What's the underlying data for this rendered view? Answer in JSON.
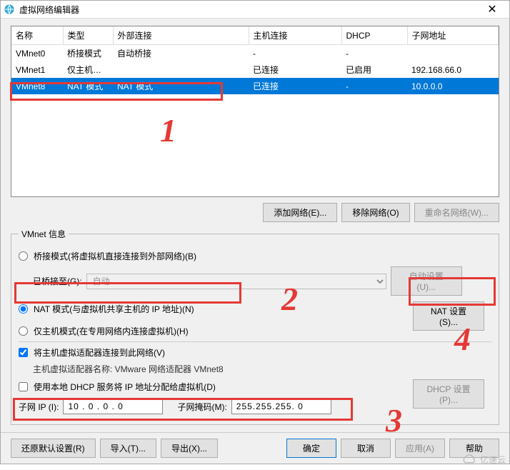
{
  "window": {
    "title": "虚拟网络编辑器",
    "close": "✕"
  },
  "headers": {
    "name": "名称",
    "type": "类型",
    "ext": "外部连接",
    "host": "主机连接",
    "dhcp": "DHCP",
    "subnet": "子网地址"
  },
  "rows": [
    {
      "name": "VMnet0",
      "type": "桥接模式",
      "ext": "自动桥接",
      "host": "-",
      "dhcp": "-",
      "subnet": ""
    },
    {
      "name": "VMnet1",
      "type": "仅主机…",
      "ext": "",
      "host": "已连接",
      "dhcp": "已启用",
      "subnet": "192.168.66.0"
    },
    {
      "name": "VMnet8",
      "type": "NAT 模式",
      "ext": "NAT 模式",
      "host": "已连接",
      "dhcp": "-",
      "subnet": "10.0.0.0"
    }
  ],
  "buttons": {
    "add": "添加网络(E)...",
    "remove": "移除网络(O)",
    "rename": "重命名网络(W)...",
    "restore": "还原默认设置(R)",
    "import": "导入(T)...",
    "export": "导出(X)...",
    "ok": "确定",
    "cancel": "取消",
    "apply": "应用(A)",
    "help": "帮助"
  },
  "info": {
    "legend": "VMnet 信息",
    "bridged": "桥接模式(将虚拟机直接连接到外部网络)(B)",
    "bridged_to_label": "已桥接至(G):",
    "bridged_to_value": "自动",
    "auto_set": "自动设置(U)...",
    "nat": "NAT 模式(与虚拟机共享主机的 IP 地址)(N)",
    "nat_set": "NAT 设置(S)...",
    "hostonly": "仅主机模式(在专用网络内连接虚拟机)(H)",
    "connect_adapter": "将主机虚拟适配器连接到此网络(V)",
    "adapter_name": "主机虚拟适配器名称: VMware 网络适配器 VMnet8",
    "use_dhcp": "使用本地 DHCP 服务将 IP 地址分配给虚拟机(D)",
    "dhcp_set": "DHCP 设置(P)...",
    "subnet_ip_label": "子网 IP (I):",
    "subnet_ip_value": "10 . 0 . 0 . 0",
    "subnet_mask_label": "子网掩码(M):",
    "subnet_mask_value": "255.255.255. 0"
  },
  "watermark": "亿速云",
  "ann": {
    "n1": "1",
    "n2": "2",
    "n3": "3",
    "n4": "4"
  }
}
